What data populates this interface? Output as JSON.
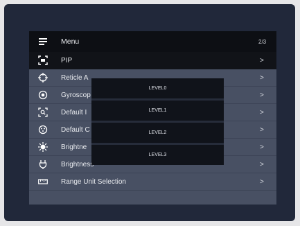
{
  "menu": {
    "title": "Menu",
    "page": "2/3",
    "items": [
      {
        "label": "PIP",
        "icon": "pip-icon"
      },
      {
        "label": "Reticle A",
        "icon": "reticle-icon"
      },
      {
        "label": "Gyroscop",
        "icon": "gyroscope-icon"
      },
      {
        "label": "Default I",
        "icon": "default-zoom-icon"
      },
      {
        "label": "Default C",
        "icon": "default-color-icon"
      },
      {
        "label": "Brightne",
        "icon": "brightness-icon"
      },
      {
        "label": "Brightness",
        "icon": "plug-icon"
      },
      {
        "label": "Range Unit Selection",
        "icon": "ruler-icon"
      }
    ],
    "chevron": ">"
  },
  "popup": {
    "options": [
      "LEVEL0",
      "LEVEL1",
      "LEVEL2",
      "LEVEL3"
    ]
  },
  "colors": {
    "screen": "#21283a",
    "panel": "#485063",
    "header": "#0d0f14",
    "popup_item": "#10131a",
    "text": "#e8eaee"
  }
}
